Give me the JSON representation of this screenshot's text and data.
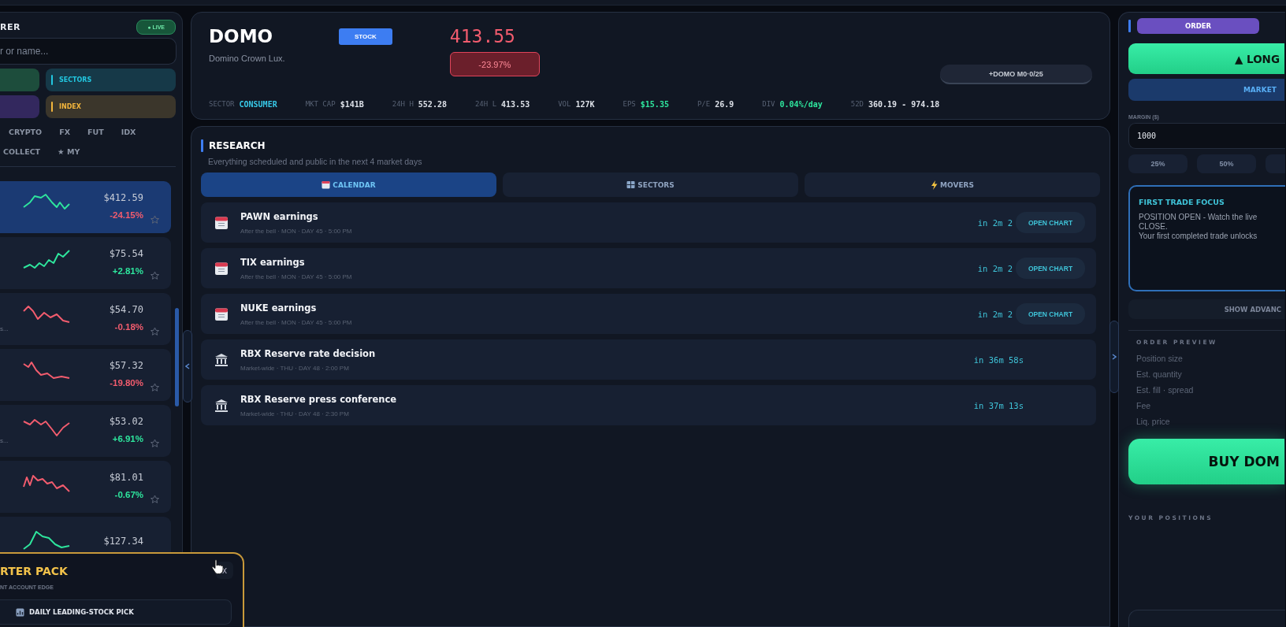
{
  "screener": {
    "title": "RER",
    "live_badge": "● LIVE",
    "search": {
      "placeholder": "r or name..."
    },
    "filters": [
      {
        "color": "#1d4d3c"
      },
      {
        "label": "SECTORS",
        "color": "#22c7e0"
      },
      {
        "color": "#33285e"
      },
      {
        "label": "INDEX",
        "color": "#f2b53c"
      }
    ],
    "asset_tabs": [
      "CRYPTO",
      "FX",
      "FUT",
      "IDX"
    ],
    "list_tabs": [
      "COLLECT",
      "★ MY"
    ],
    "stocks": [
      {
        "price": "$412.59",
        "change": "-24.15%",
        "change_positive": false,
        "color": "#2ee59d",
        "selected": true
      },
      {
        "price": "$75.54",
        "change": "+2.81%",
        "change_positive": true,
        "color": "#2ee59d",
        "selected": false
      },
      {
        "name": "s...",
        "price": "$54.70",
        "change": "-0.18%",
        "change_positive": false,
        "color": "#f25c6e",
        "selected": false
      },
      {
        "price": "$57.32",
        "change": "-19.80%",
        "change_positive": false,
        "color": "#f25c6e",
        "selected": false
      },
      {
        "name": "s...",
        "price": "$53.02",
        "change": "+6.91%",
        "change_positive": true,
        "color": "#f25c6e",
        "selected": false
      },
      {
        "price": "$81.01",
        "change": "-0.67%",
        "change_positive": true,
        "color": "#f25c6e",
        "selected": false
      },
      {
        "price": "$127.34",
        "color": "#2ee59d",
        "selected": false
      }
    ]
  },
  "starter_pack": {
    "title": "RTER PACK",
    "subtitle": "NT ACCOUNT EDGE",
    "close": "x",
    "perks": [
      "DAILY LEADING-STOCK PICK"
    ]
  },
  "quote": {
    "symbol": "DOMO",
    "name": "Domino Crown Lux.",
    "type_badge": "STOCK",
    "price": "413.55",
    "change": "-23.97%",
    "change_positive": false,
    "watch_pill": "+DOMO M0·0/25",
    "stats": [
      {
        "label": "SECTOR",
        "value": "CONSUMER",
        "color": "#38c9e8"
      },
      {
        "label": "MKT CAP",
        "value": "$141B"
      },
      {
        "label": "24H H",
        "value": "552.28"
      },
      {
        "label": "24H L",
        "value": "413.53"
      },
      {
        "label": "VOL",
        "value": "127K"
      },
      {
        "label": "EPS",
        "value": "$15.35",
        "color": "#2ee59d"
      },
      {
        "label": "P/E",
        "value": "26.9"
      },
      {
        "label": "DIV",
        "value": "0.04%/day",
        "color": "#2ee59d"
      },
      {
        "label": "52D",
        "value": "360.19 - 974.18"
      }
    ]
  },
  "research": {
    "title": "RESEARCH",
    "subtitle": "Everything scheduled and public in the next 4 market days",
    "tabs": [
      {
        "label": "CALENDAR",
        "selected": true
      },
      {
        "label": "SECTORS",
        "selected": false
      },
      {
        "label": "MOVERS",
        "selected": false
      }
    ],
    "events": [
      {
        "kind": "earnings",
        "title": "PAWN earnings",
        "detail": "After the bell · MON · DAY 45 · 5:00 PM",
        "countdown": "in 2m 2",
        "action": "OPEN CHART"
      },
      {
        "kind": "earnings",
        "title": "TIX earnings",
        "detail": "After the bell · MON · DAY 45 · 5:00 PM",
        "countdown": "in 2m 2",
        "action": "OPEN CHART"
      },
      {
        "kind": "earnings",
        "title": "NUKE earnings",
        "detail": "After the bell · MON · DAY 45 · 5:00 PM",
        "countdown": "in 2m 2",
        "action": "OPEN CHART"
      },
      {
        "kind": "macro",
        "title": "RBX Reserve rate decision",
        "detail": "Market-wide · THU · DAY 48 · 2:00 PM",
        "countdown": "in 36m 58s"
      },
      {
        "kind": "macro",
        "title": "RBX Reserve press conference",
        "detail": "Market-wide · THU · DAY 48 · 2:30 PM",
        "countdown": "in 37m 13s"
      }
    ]
  },
  "order": {
    "title": "ORDER",
    "side": "▲ LONG",
    "order_type": "MARKET",
    "margin": {
      "label": "MARGIN ($)",
      "value": "1000"
    },
    "presets": [
      {
        "label": "25%"
      },
      {
        "label": "50%"
      },
      {
        "kind": "cut"
      }
    ],
    "focus": {
      "title": "FIRST TRADE FOCUS",
      "text": "POSITION OPEN  -  Watch the live\nCLOSE.\nYour first completed trade unlocks"
    },
    "advanced_button": "SHOW ADVANC",
    "preview": {
      "title": "ORDER PREVIEW",
      "rows": [
        "Position size",
        "Est. quantity",
        "Est. fill · spread",
        "Fee",
        "Liq. price"
      ]
    },
    "submit": "BUY DOM",
    "positions_title": "YOUR POSITIONS"
  }
}
